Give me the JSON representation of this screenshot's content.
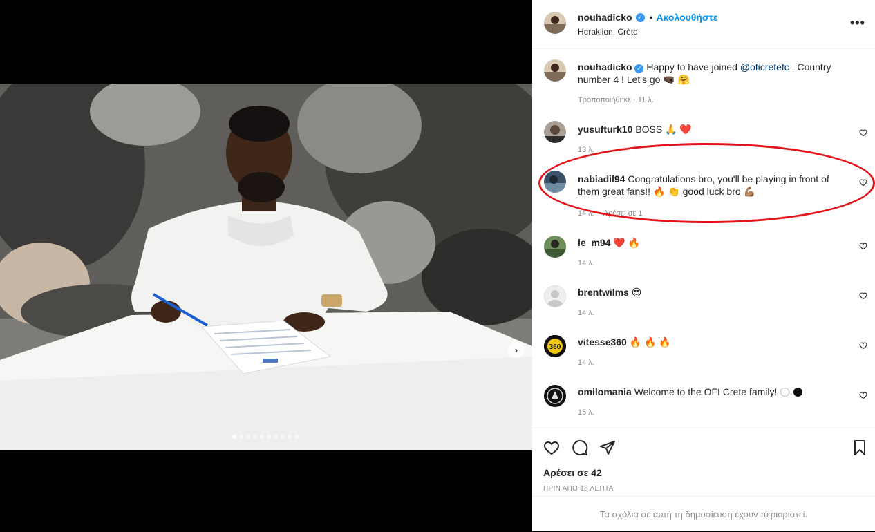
{
  "post": {
    "username": "nouhadicko",
    "verified_icon": "✓",
    "separator": "•",
    "follow_label": "Ακολουθήστε",
    "location": "Heraklion, Crète",
    "more_icon": "more-options-icon",
    "more_label": "•••",
    "carousel_dots": 10,
    "next_label": "›"
  },
  "caption": {
    "user": "nouhadicko",
    "text_before": "Happy to have joined ",
    "mention": "@oficretefc",
    "text_after": " . Country number 4 ! Let's go",
    "emojis": [
      "🤜🏿",
      "🤗"
    ],
    "meta": "Τροποποιήθηκε · 11 λ."
  },
  "comments": [
    {
      "user": "yusufturk10",
      "text": "BOSS",
      "emojis": [
        "🙏",
        "❤️"
      ],
      "meta": "13 λ."
    },
    {
      "user": "nabiadil94",
      "text": "Congratulations bro, you'll be playing in front of them great fans!!",
      "emojis": [
        "🔥",
        "👏"
      ],
      "text2": "good luck bro",
      "emojis2": [
        "💪🏽"
      ],
      "meta_time": "14 λ.",
      "meta_likes": "Αρέσει σε 1"
    },
    {
      "user": "le_m94",
      "text": "",
      "emojis": [
        "❤️",
        "🔥"
      ],
      "meta": "14 λ."
    },
    {
      "user": "brentwilms",
      "text": "",
      "emojis": [
        "😍"
      ],
      "meta": "14 λ."
    },
    {
      "user": "vitesse360",
      "text": "",
      "emojis": [
        "🔥",
        "🔥",
        "🔥"
      ],
      "meta": "14 λ."
    },
    {
      "user": "omilomania",
      "text": "Welcome to the OFI Crete family!",
      "emojis": [
        "⚪",
        "⚫"
      ],
      "meta": "15 λ."
    }
  ],
  "avatar_badges": {
    "vitesse360": "360"
  },
  "actions": {
    "likes": "Αρέσει σε 42",
    "time_ago": "ΠΡΙΝ ΑΠΟ 18 ΛΕΠΤΑ",
    "limited_notice": "Τα σχόλια σε αυτή τη δημοσίευση έχουν περιοριστεί."
  },
  "colors": {
    "link_blue": "#0095f6",
    "mention_blue": "#00376b",
    "verified_blue": "#3897f0",
    "annotation_red": "#e3141b"
  }
}
